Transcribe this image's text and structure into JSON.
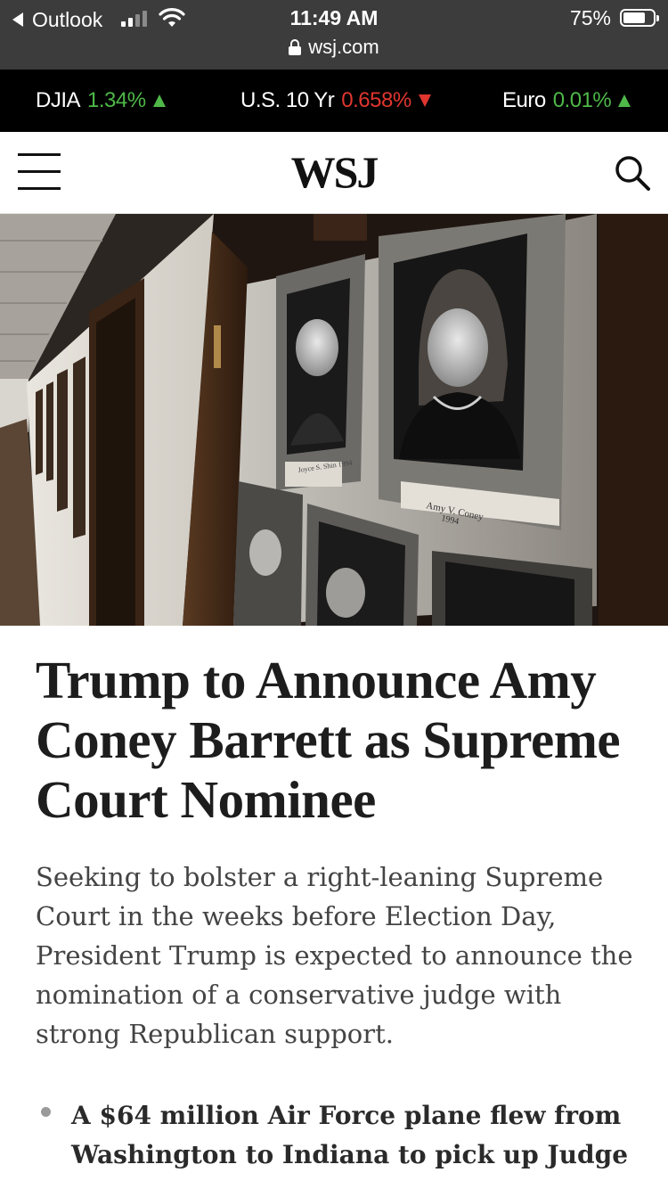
{
  "status_bar": {
    "back_app": "Outlook",
    "time": "11:49 AM",
    "battery_percent": "75%",
    "battery_level": 0.75,
    "url": "wsj.com",
    "signal_bars_active": 2,
    "signal_bars_total": 4
  },
  "ticker": [
    {
      "name": "DJIA",
      "value": "1.34%",
      "direction": "up",
      "color": "#4fb848"
    },
    {
      "name": "U.S. 10 Yr",
      "value": "0.658%",
      "direction": "down",
      "color": "#e0362f"
    },
    {
      "name": "Euro",
      "value": "0.01%",
      "direction": "up",
      "color": "#4fb848"
    }
  ],
  "header": {
    "logo": "WSJ",
    "menu_icon": "hamburger-icon",
    "search_icon": "search-icon"
  },
  "hero": {
    "nameplate_1": "Joyce S. Shin 1994",
    "nameplate_2_line1": "Amy V. Coney",
    "nameplate_2_line2": "1994"
  },
  "article": {
    "headline": "Trump to Announce Amy Coney Barrett as Supreme Court Nominee",
    "dek": "Seeking to bolster a right-leaning Supreme Court in the weeks before Election Day, President Trump is expected to announce the nomination of a conservative judge with strong Republican support.",
    "bullets": [
      "A $64 million Air Force plane flew from Washington to Indiana to pick up Judge"
    ]
  }
}
